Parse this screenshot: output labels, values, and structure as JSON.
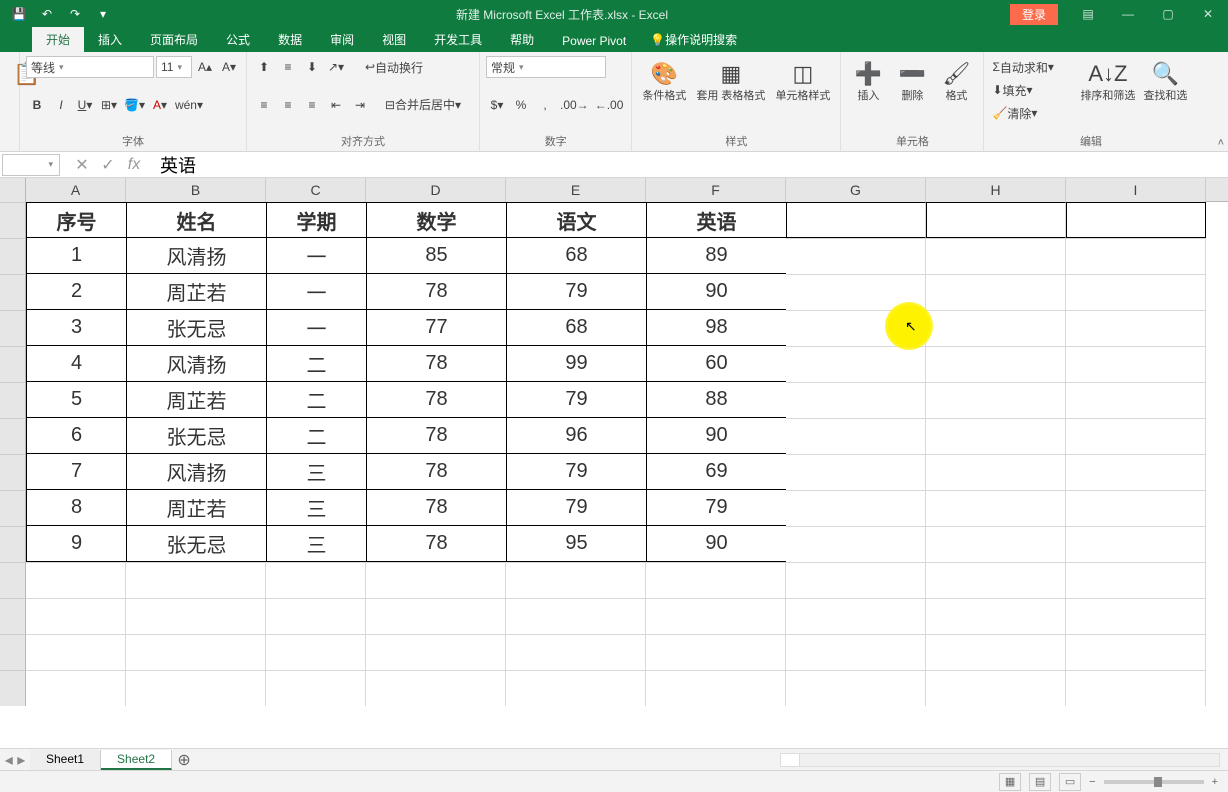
{
  "app": {
    "title": "新建 Microsoft Excel 工作表.xlsx - Excel",
    "login": "登录"
  },
  "tabs": {
    "file": "",
    "home": "开始",
    "insert": "插入",
    "layout": "页面布局",
    "formulas": "公式",
    "data": "数据",
    "review": "审阅",
    "view": "视图",
    "developer": "开发工具",
    "help": "帮助",
    "powerpivot": "Power Pivot",
    "tellme": "操作说明搜索"
  },
  "ribbon": {
    "font": {
      "name": "等线",
      "size": "11",
      "group": "字体"
    },
    "align": {
      "wrap": "自动换行",
      "merge": "合并后居中",
      "group": "对齐方式"
    },
    "number": {
      "format": "常规",
      "group": "数字"
    },
    "styles": {
      "cond": "条件格式",
      "table": "套用\n表格格式",
      "cell": "单元格样式",
      "group": "样式"
    },
    "cells": {
      "insert": "插入",
      "delete": "删除",
      "format": "格式",
      "group": "单元格"
    },
    "editing": {
      "sum": "自动求和",
      "fill": "填充",
      "clear": "清除",
      "sort": "排序和筛选",
      "find": "查找和选",
      "group": "编辑"
    }
  },
  "namebox": "",
  "formula": "英语",
  "columns": [
    "A",
    "B",
    "C",
    "D",
    "E",
    "F",
    "G",
    "H",
    "I"
  ],
  "col_widths": [
    "col-A",
    "col-B",
    "col-C",
    "col-D",
    "col-E",
    "col-F",
    "col-G",
    "col-H",
    "col-I"
  ],
  "table": {
    "headers": [
      "序号",
      "姓名",
      "学期",
      "数学",
      "语文",
      "英语"
    ],
    "rows": [
      [
        "1",
        "风清扬",
        "一",
        "85",
        "68",
        "89"
      ],
      [
        "2",
        "周芷若",
        "一",
        "78",
        "79",
        "90"
      ],
      [
        "3",
        "张无忌",
        "一",
        "77",
        "68",
        "98"
      ],
      [
        "4",
        "风清扬",
        "二",
        "78",
        "99",
        "60"
      ],
      [
        "5",
        "周芷若",
        "二",
        "78",
        "79",
        "88"
      ],
      [
        "6",
        "张无忌",
        "二",
        "78",
        "96",
        "90"
      ],
      [
        "7",
        "风清扬",
        "三",
        "78",
        "79",
        "69"
      ],
      [
        "8",
        "周芷若",
        "三",
        "78",
        "79",
        "79"
      ],
      [
        "9",
        "张无忌",
        "三",
        "78",
        "95",
        "90"
      ]
    ]
  },
  "sheets": [
    "Sheet1",
    "Sheet2"
  ],
  "active_sheet": 1
}
